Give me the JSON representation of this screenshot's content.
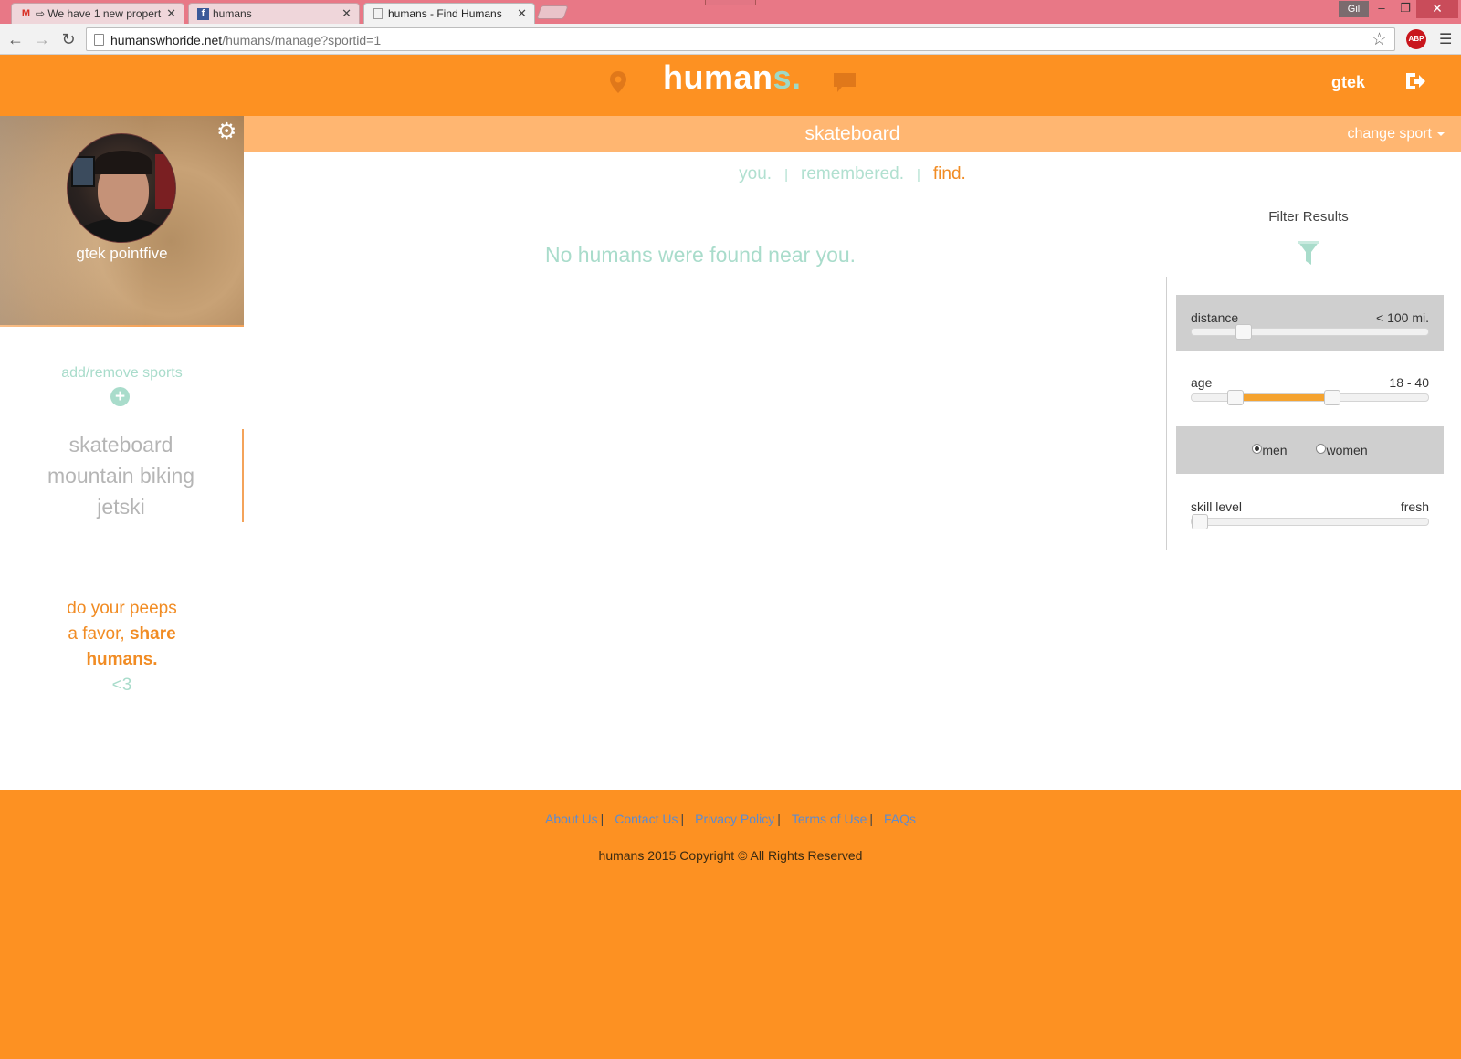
{
  "browser": {
    "tabs": [
      {
        "icon": "gmail-icon",
        "title": "⇨ We have 1 new propert",
        "active": false
      },
      {
        "icon": "facebook-icon",
        "title": "humans",
        "active": false
      },
      {
        "icon": "page-icon",
        "title": "humans - Find Humans",
        "active": true
      }
    ],
    "profile_badge": "Gil",
    "url_host": "humanswhoride.net",
    "url_path": "/humans/manage?sportid=1",
    "abp_label": "ABP"
  },
  "header": {
    "logo_main": "human",
    "logo_accent": "s.",
    "username": "gtek",
    "colors": {
      "brand": "#fd9122",
      "accent": "#9ed9c6"
    }
  },
  "sport_bar": {
    "current_sport": "skateboard",
    "change_sport_label": "change sport"
  },
  "profile": {
    "name": "gtek pointfive"
  },
  "sidebar": {
    "add_remove_label": "add/remove sports",
    "sports": [
      "skateboard",
      "mountain biking",
      "jetski"
    ],
    "share_line1": "do your peeps",
    "share_line2_prefix": "a favor, ",
    "share_line2_bold": "share",
    "share_line3": "humans.",
    "share_heart": "<3"
  },
  "subnav": {
    "tabs": [
      {
        "label": "you.",
        "active": false
      },
      {
        "label": "remembered.",
        "active": false
      },
      {
        "label": "find.",
        "active": true
      }
    ]
  },
  "main": {
    "empty_message": "No humans were found near you."
  },
  "filters": {
    "title": "Filter Results",
    "distance": {
      "label": "distance",
      "value": "< 100 mi.",
      "position": 0.2
    },
    "age": {
      "label": "age",
      "value": "18 - 40",
      "low": 0.16,
      "high": 0.6
    },
    "gender": {
      "options": [
        "men",
        "women"
      ],
      "selected": "men"
    },
    "skill": {
      "label": "skill level",
      "value": "fresh",
      "position": 0
    }
  },
  "footer": {
    "links": [
      "About Us",
      "Contact Us",
      "Privacy Policy",
      "Terms of Use",
      "FAQs"
    ],
    "copyright": "humans 2015 Copyright © All Rights Reserved"
  }
}
